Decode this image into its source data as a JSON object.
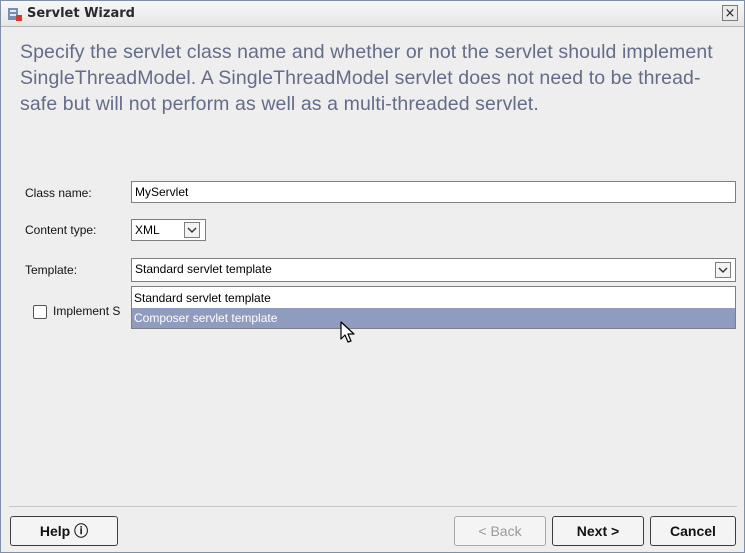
{
  "window": {
    "title": "Servlet Wizard",
    "close_label": "×"
  },
  "description": "Specify the servlet class name and whether or not the servlet should implement SingleThreadModel. A SingleThreadModel servlet does not need to be thread-safe but will not perform as well as a multi-threaded servlet.",
  "form": {
    "class_name": {
      "label": "Class name:",
      "value": "MyServlet"
    },
    "content_type": {
      "label": "Content type:",
      "value": "XML"
    },
    "template": {
      "label": "Template:",
      "value": "Standard servlet template",
      "options": [
        "Standard servlet template",
        "Composer servlet template"
      ],
      "highlighted": "Composer servlet template"
    },
    "implement_stm": {
      "label": "Implement S",
      "checked": false
    }
  },
  "buttons": {
    "help": "Help ⓘ",
    "back": "< Back",
    "next": "Next >",
    "cancel": "Cancel"
  },
  "icons": {
    "title": "wizard-icon",
    "cursor": "mouse-pointer-icon"
  }
}
